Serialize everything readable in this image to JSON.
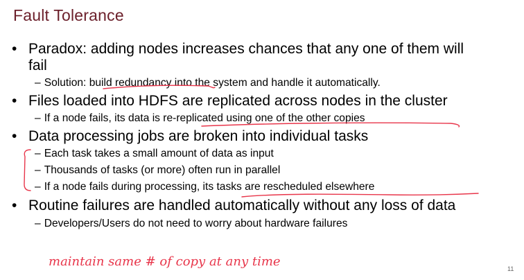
{
  "slide": {
    "title": "Fault Tolerance",
    "page_number": "11",
    "bullets": [
      {
        "text_line1": "Paradox: adding nodes increases chances that any one of them will",
        "text_line2": "fail",
        "subs": [
          "Solution: build redundancy into the system and handle it automatically."
        ]
      },
      {
        "text": "Files loaded into HDFS are replicated across nodes in the cluster",
        "subs": [
          "If a node fails, its data is re-replicated using one of the other copies"
        ]
      },
      {
        "text": "Data processing jobs are broken into individual tasks",
        "subs": [
          "Each task takes a small amount of data as input",
          "Thousands of tasks (or more) often run in parallel",
          "If a node fails during processing, its tasks are rescheduled elsewhere"
        ]
      },
      {
        "text": "Routine failures are handled automatically without any loss of data",
        "subs": [
          "Developers/Users do not need to worry about hardware failures"
        ]
      }
    ],
    "handwritten_note": "maintain same # of copy at any time",
    "bullet_glyph": "•",
    "dash_glyph": "–",
    "annotation_color": "#e8354a",
    "title_color": "#6b1f2a"
  }
}
